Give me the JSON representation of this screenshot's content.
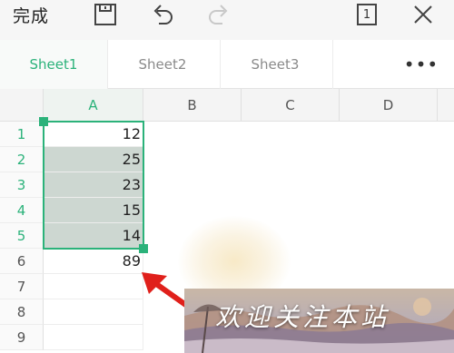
{
  "toolbar": {
    "done_label": "完成",
    "icons": [
      "save-icon",
      "undo-icon",
      "redo-icon",
      "pages-icon",
      "close-icon"
    ],
    "pages_count": "1"
  },
  "tabs": [
    {
      "label": "Sheet1",
      "active": true
    },
    {
      "label": "Sheet2",
      "active": false
    },
    {
      "label": "Sheet3",
      "active": false
    }
  ],
  "more_label": "•••",
  "columns": [
    "A",
    "B",
    "C",
    "D"
  ],
  "rows": [
    "1",
    "2",
    "3",
    "4",
    "5",
    "6",
    "7",
    "8",
    "9"
  ],
  "column_a_values": [
    "12",
    "25",
    "23",
    "15",
    "14",
    "89",
    "",
    "",
    ""
  ],
  "selection": "A1:A5",
  "watermark_text": "欢迎关注本站",
  "colors": {
    "accent": "#2bb27a",
    "selection_fill": "#cdd7d1",
    "arrow": "#e0201b"
  }
}
